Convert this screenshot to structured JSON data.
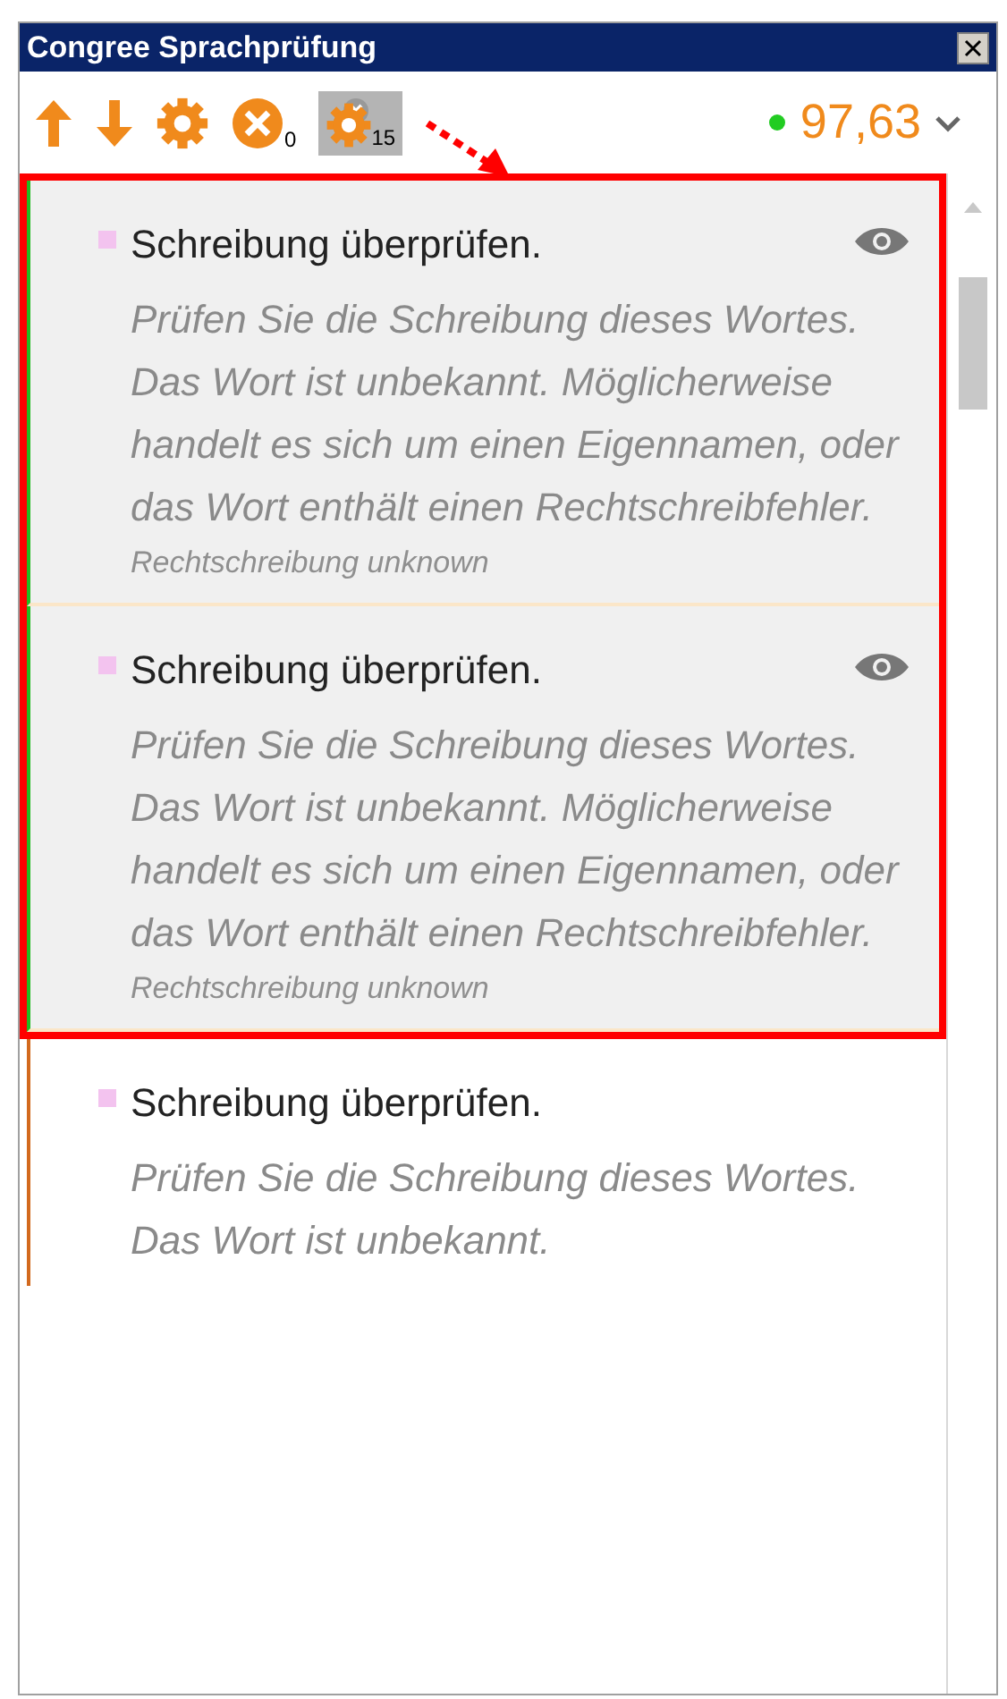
{
  "window": {
    "title": "Congree Sprachprüfung"
  },
  "toolbar": {
    "error_count": "0",
    "filter_count": "15",
    "filter_pressed": true,
    "score": "97,63"
  },
  "cards": [
    {
      "title": "Schreibung überprüfen.",
      "description": [
        "Prüfen Sie die Schreibung dieses Wortes.",
        "Das Wort ist unbekannt. Möglicherweise handelt es sich um einen Eigennamen, oder das Wort enthält einen Rechtschreibfehler."
      ],
      "source": "Rechtschreibung unknown",
      "selected": true,
      "color": "#22bb22"
    },
    {
      "title": "Schreibung überprüfen.",
      "description": [
        "Prüfen Sie die Schreibung dieses Wortes.",
        "Das Wort ist unbekannt. Möglicherweise handelt es sich um einen Eigennamen, oder das Wort enthält einen Rechtschreibfehler."
      ],
      "source": "Rechtschreibung unknown",
      "selected": true,
      "color": "#22bb22"
    },
    {
      "title": "Schreibung überprüfen.",
      "description": [
        "Prüfen Sie die Schreibung dieses Wortes.",
        "Das Wort ist unbekannt."
      ],
      "selected": false,
      "color": "#d2691e"
    }
  ]
}
